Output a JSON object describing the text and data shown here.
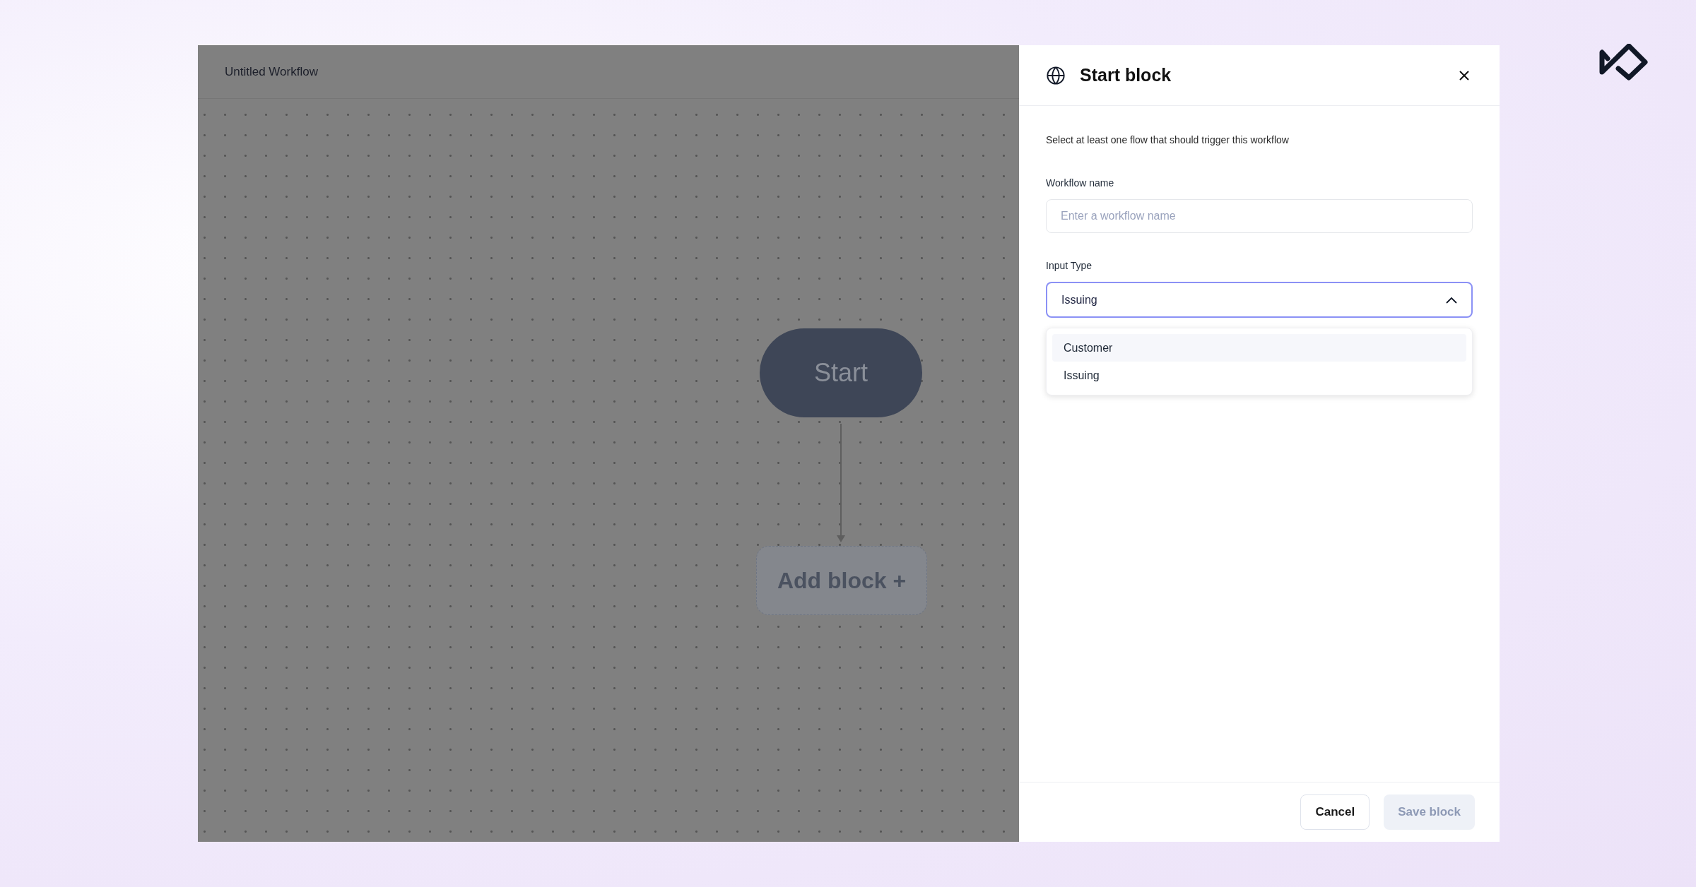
{
  "canvas": {
    "title": "Untitled Workflow",
    "nodes": [
      {
        "kind": "start",
        "label": "Start"
      },
      {
        "kind": "add",
        "label": "Add block +"
      }
    ]
  },
  "panel": {
    "title": "Start block",
    "description": "Select at least one flow that should trigger this workflow",
    "fields": [
      {
        "kind": "text",
        "label": "Workflow name",
        "placeholder": "Enter a workflow name"
      },
      {
        "kind": "select",
        "label": "Input Type",
        "value": "Issuing",
        "expanded": true,
        "options": [
          {
            "label": "Customer",
            "highlighted": true
          },
          {
            "label": "Issuing",
            "highlighted": false
          }
        ]
      }
    ],
    "buttons": [
      {
        "label": "Cancel",
        "kind": "secondary",
        "disabled": false
      },
      {
        "label": "Save block",
        "kind": "primary",
        "disabled": true
      }
    ]
  }
}
